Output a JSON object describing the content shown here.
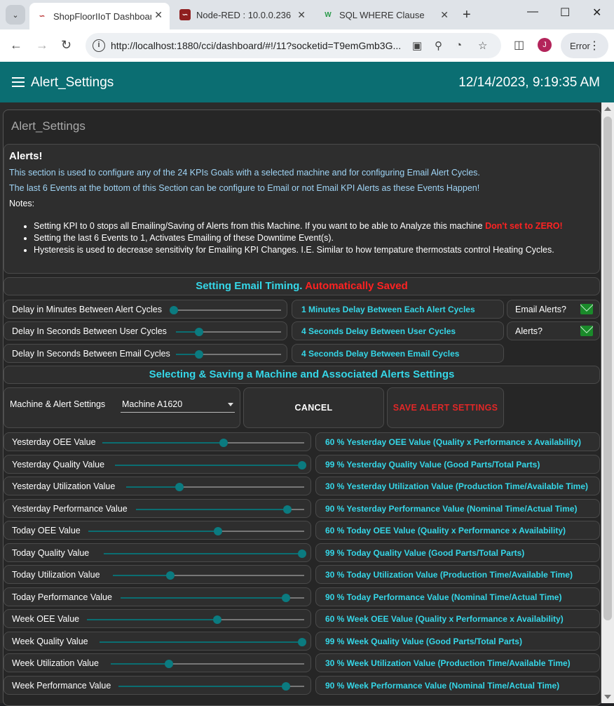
{
  "browser": {
    "tabs": [
      {
        "title": "ShopFloorIIoT Dashboard",
        "active": true
      },
      {
        "title": "Node-RED : 10.0.0.236",
        "active": false
      },
      {
        "title": "SQL WHERE Clause",
        "active": false
      }
    ],
    "url": "http://localhost:1880/cci/dashboard/#!/11?socketid=T9emGmb3G...",
    "profile_initial": "J",
    "error_label": "Error"
  },
  "app": {
    "title": "Alert_Settings",
    "datetime": "12/14/2023, 9:19:35 AM",
    "group_title": "Alert_Settings"
  },
  "alerts": {
    "heading": "Alerts!",
    "line1": "This section is used to configure any of the 24 KPIs Goals with a selected machine and for configuring Email Alert Cycles.",
    "line2": "The last 6 Events at the bottom of this Section can be configure to Email or not Email KPI Alerts as these Events Happen!",
    "notes_label": "Notes:",
    "note1": "Setting KPI to 0 stops all Emailing/Saving of Alerts from this Machine. If you want to be able to Analyze this machine ",
    "note1_warning": "Don't set to ZERO!",
    "note2": "Setting the last 6 Events to 1, Activates Emailing of these Downtime Event(s).",
    "note3": "Hysteresis is used to decrease sensitivity for Emailing KPI Changes. I.E. Similar to how tempature thermostats control Heating Cycles."
  },
  "email_timing": {
    "heading": "Setting Email Timing. ",
    "heading_red": "Automatically Saved",
    "rows": [
      {
        "label": "Delay in Minutes Between Alert Cycles",
        "value_fraction": 0.0,
        "status": "1 Minutes Delay Between Each Alert Cycles"
      },
      {
        "label": "Delay In Seconds Between User Cycles",
        "value_fraction": 0.22,
        "status": "4 Seconds Delay Between User Cycles"
      },
      {
        "label": "Delay In Seconds Between Email Cycles",
        "value_fraction": 0.22,
        "status": "4 Seconds Delay Between Email Cycles"
      }
    ],
    "toggles": [
      {
        "label": "Email Alerts?",
        "icon": "mail-icon",
        "on": true
      },
      {
        "label": "Alerts?",
        "icon": "mail-icon",
        "on": true
      }
    ]
  },
  "machine_section": {
    "heading": "Selecting & Saving a Machine and Associated Alerts Settings",
    "select_label": "Machine & Alert Settings",
    "selected_machine": "Machine A1620",
    "cancel_label": "CANCEL",
    "save_label": "SAVE ALERT SETTINGS"
  },
  "kpis": [
    {
      "label": "Yesterday OEE Value",
      "value": 60,
      "status": "60 % Yesterday OEE Value (Quality x Performance x Availability)"
    },
    {
      "label": "Yesterday Quality Value",
      "value": 99,
      "status": "99 % Yesterday Quality Value (Good Parts/Total Parts)"
    },
    {
      "label": "Yesterday Utilization Value",
      "value": 30,
      "status": "30 % Yesterday Utilization Value (Production Time/Available Time)"
    },
    {
      "label": "Yesterday Performance Value",
      "value": 90,
      "status": "90 % Yesterday Performance Value (Nominal Time/Actual Time)"
    },
    {
      "label": "Today OEE Value",
      "value": 60,
      "status": "60 % Today OEE Value (Quality x Performance x Availability)"
    },
    {
      "label": "Today Quality Value",
      "value": 99,
      "status": "99 % Today Quality Value (Good Parts/Total Parts)"
    },
    {
      "label": "Today Utilization Value",
      "value": 30,
      "status": "30 % Today Utilization Value (Production Time/Available Time)"
    },
    {
      "label": "Today Performance Value",
      "value": 90,
      "status": "90 % Today Performance Value (Nominal Time/Actual Time)"
    },
    {
      "label": "Week OEE Value",
      "value": 60,
      "status": "60 % Week OEE Value (Quality x Performance x Availability)"
    },
    {
      "label": "Week Quality Value",
      "value": 99,
      "status": "99 % Week Quality Value (Good Parts/Total Parts)"
    },
    {
      "label": "Week Utilization Value",
      "value": 30,
      "status": "30 % Week Utilization Value (Production Time/Available Time)"
    },
    {
      "label": "Week Performance Value",
      "value": 90,
      "status": "90 % Week Performance Value (Nominal Time/Actual Time)"
    }
  ],
  "colors": {
    "accent": "#0b6e72",
    "value_text": "#35d7e8",
    "warning": "#ff2222"
  }
}
